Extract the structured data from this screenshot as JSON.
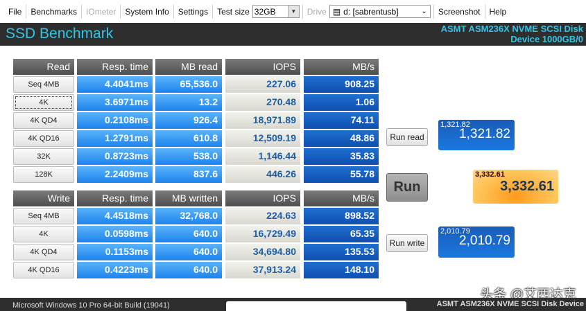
{
  "menu": {
    "file": "File",
    "benchmarks": "Benchmarks",
    "iometer": "IOmeter",
    "system_info": "System Info",
    "settings": "Settings",
    "test_size_label": "Test size",
    "test_size": "32GB",
    "drive_label": "Drive",
    "drive": "d: [sabrentusb]",
    "screenshot": "Screenshot",
    "help": "Help"
  },
  "header": {
    "title": "SSD Benchmark",
    "device_line1": "ASMT ASM236X NVME SCSI Disk",
    "device_line2": "Device 1000GB/0"
  },
  "read": {
    "headers": [
      "Read",
      "Resp. time",
      "MB read",
      "IOPS",
      "MB/s"
    ],
    "rows": [
      [
        "Seq 4MB",
        "4.4041ms",
        "65,536.0",
        "227.06",
        "908.25"
      ],
      [
        "4K",
        "3.6971ms",
        "13.2",
        "270.48",
        "1.06"
      ],
      [
        "4K QD4",
        "0.2108ms",
        "926.4",
        "18,971.89",
        "74.11"
      ],
      [
        "4K QD16",
        "1.2791ms",
        "610.8",
        "12,509.19",
        "48.86"
      ],
      [
        "32K",
        "0.8723ms",
        "538.0",
        "1,146.44",
        "35.83"
      ],
      [
        "128K",
        "2.2409ms",
        "837.6",
        "446.26",
        "55.78"
      ]
    ]
  },
  "write": {
    "headers": [
      "Write",
      "Resp. time",
      "MB written",
      "IOPS",
      "MB/s"
    ],
    "rows": [
      [
        "Seq 4MB",
        "4.4518ms",
        "32,768.0",
        "224.63",
        "898.52"
      ],
      [
        "4K",
        "0.0598ms",
        "640.0",
        "16,729.49",
        "65.35"
      ],
      [
        "4K QD4",
        "0.1153ms",
        "640.0",
        "34,694.80",
        "135.53"
      ],
      [
        "4K QD16",
        "0.4223ms",
        "640.0",
        "37,913.24",
        "148.10"
      ]
    ]
  },
  "actions": {
    "run_read": "Run read",
    "run": "Run",
    "run_write": "Run write"
  },
  "scores": {
    "read_small": "1,321.82",
    "read": "1,321.82",
    "total_small": "3,332.61",
    "total": "3,332.61",
    "write_small": "2,010.79",
    "write": "2,010.79"
  },
  "footer": {
    "os": "Microsoft Windows 10 Pro 64-bit Build (19041)",
    "device": "ASMT ASM236X NVME SCSI Disk Device"
  },
  "watermark": "头条 @艾西达克"
}
